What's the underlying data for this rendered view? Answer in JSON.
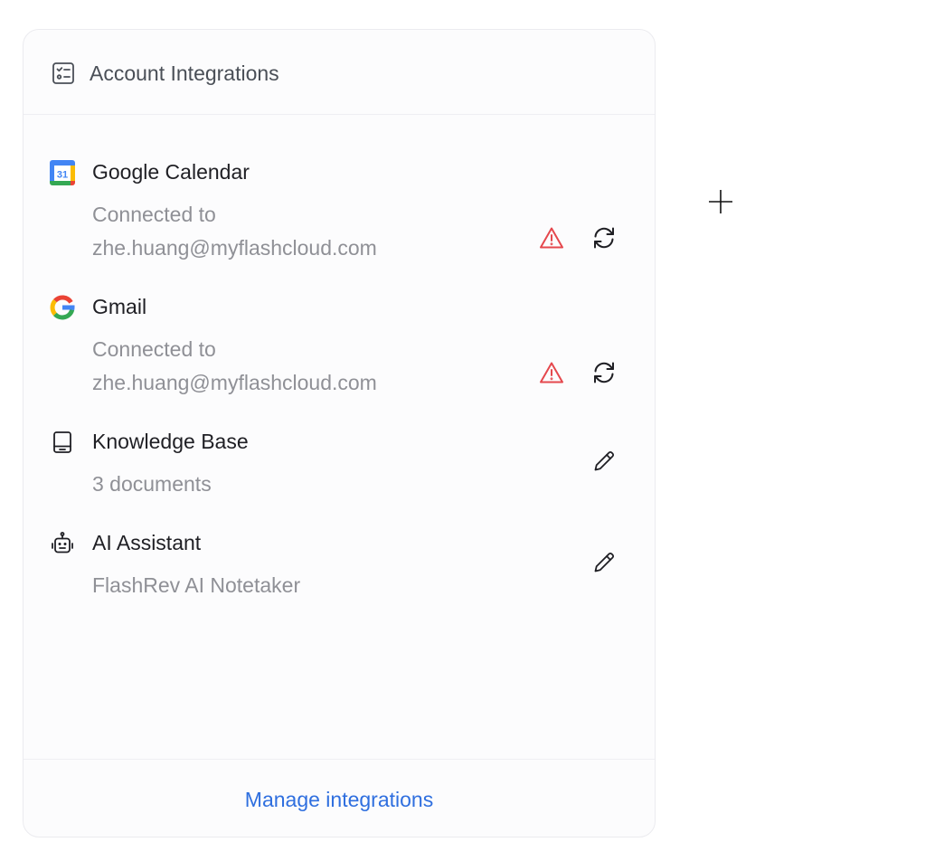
{
  "card": {
    "title": "Account Integrations",
    "header_icon": "checklist-icon"
  },
  "integrations": [
    {
      "name": "Google Calendar",
      "icon": "google-calendar-icon",
      "status_line1": "Connected to",
      "status_line2": "zhe.huang@myflashcloud.com",
      "actions": [
        "warning-icon",
        "refresh-icon"
      ]
    },
    {
      "name": "Gmail",
      "icon": "google-g-icon",
      "status_line1": "Connected to",
      "status_line2": "zhe.huang@myflashcloud.com",
      "actions": [
        "warning-icon",
        "refresh-icon"
      ]
    },
    {
      "name": "Knowledge Base",
      "icon": "book-icon",
      "status_line1": "3 documents",
      "actions": [
        "pencil-icon"
      ]
    },
    {
      "name": "AI Assistant",
      "icon": "robot-icon",
      "status_line1": "FlashRev AI Notetaker",
      "actions": [
        "pencil-icon"
      ]
    }
  ],
  "calendar_icon_day": "31",
  "footer": {
    "link_label": "Manage integrations"
  },
  "colors": {
    "link": "#2f6fdf",
    "warning": "#e5484d",
    "title_text": "#1f1f24",
    "secondary_text": "#8f9096",
    "card_background": "#fcfcfd"
  }
}
